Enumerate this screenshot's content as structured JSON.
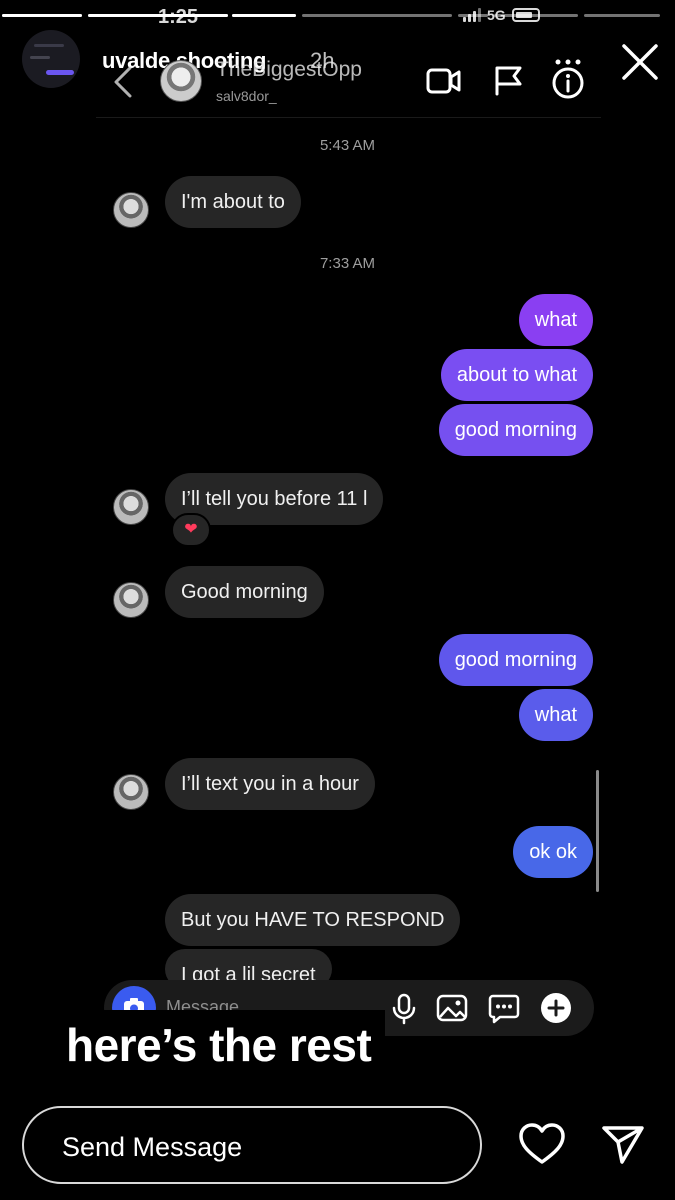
{
  "status_bar": {
    "time": "1:25",
    "network": "5G"
  },
  "story": {
    "title": "uvalde shooting",
    "age": "2h",
    "caption": "here’s the rest",
    "reply_placeholder": "Send Message",
    "progress": [
      1,
      1,
      1,
      0,
      0,
      0,
      0
    ]
  },
  "dm": {
    "contact_name": "TheBiggestOpp",
    "contact_handle": "salv8dor_",
    "composer_placeholder": "Message",
    "messages": [
      {
        "kind": "timestamp",
        "text": "5:43 AM"
      },
      {
        "kind": "incoming",
        "text": "I'm about to"
      },
      {
        "kind": "timestamp",
        "text": "7:33 AM"
      },
      {
        "kind": "outgoing",
        "text": "what"
      },
      {
        "kind": "outgoing",
        "text": "about to what"
      },
      {
        "kind": "outgoing",
        "text": "good morning"
      },
      {
        "kind": "incoming",
        "text": "I’ll tell you before 11 l",
        "reaction": "❤"
      },
      {
        "kind": "incoming",
        "text": "Good morning"
      },
      {
        "kind": "outgoing",
        "text": "good morning"
      },
      {
        "kind": "outgoing",
        "text": "what"
      },
      {
        "kind": "incoming",
        "text": "I’ll text you in a hour"
      },
      {
        "kind": "outgoing",
        "text": "ok ok"
      },
      {
        "kind": "incoming",
        "text": "But you HAVE TO RESPOND"
      },
      {
        "kind": "incoming",
        "text": "I got a lil secret"
      }
    ]
  },
  "colors": {
    "background": "#000000",
    "incoming_bubble": "#262626",
    "outgoing_gradient": [
      "#8a3ff2",
      "#7a4ef2",
      "#6a52ee",
      "#5a5ceb",
      "#4c62ea",
      "#4868e8"
    ],
    "camera_button": "#3a5bf0"
  }
}
